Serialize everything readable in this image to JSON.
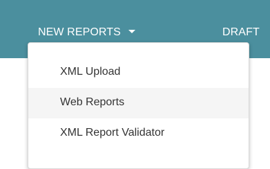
{
  "navbar": {
    "new_reports_label": "NEW REPORTS",
    "drafts_label": "DRAFT",
    "background": "#4b8f9e",
    "caret_icon": "caret-down-icon"
  },
  "dropdown": {
    "items": [
      {
        "label": "XML Upload",
        "highlighted": false
      },
      {
        "label": "Web Reports",
        "highlighted": true
      },
      {
        "label": "XML Report Validator",
        "highlighted": false
      }
    ],
    "highlight_color": "#f5f5f5",
    "text_color": "#333333"
  }
}
